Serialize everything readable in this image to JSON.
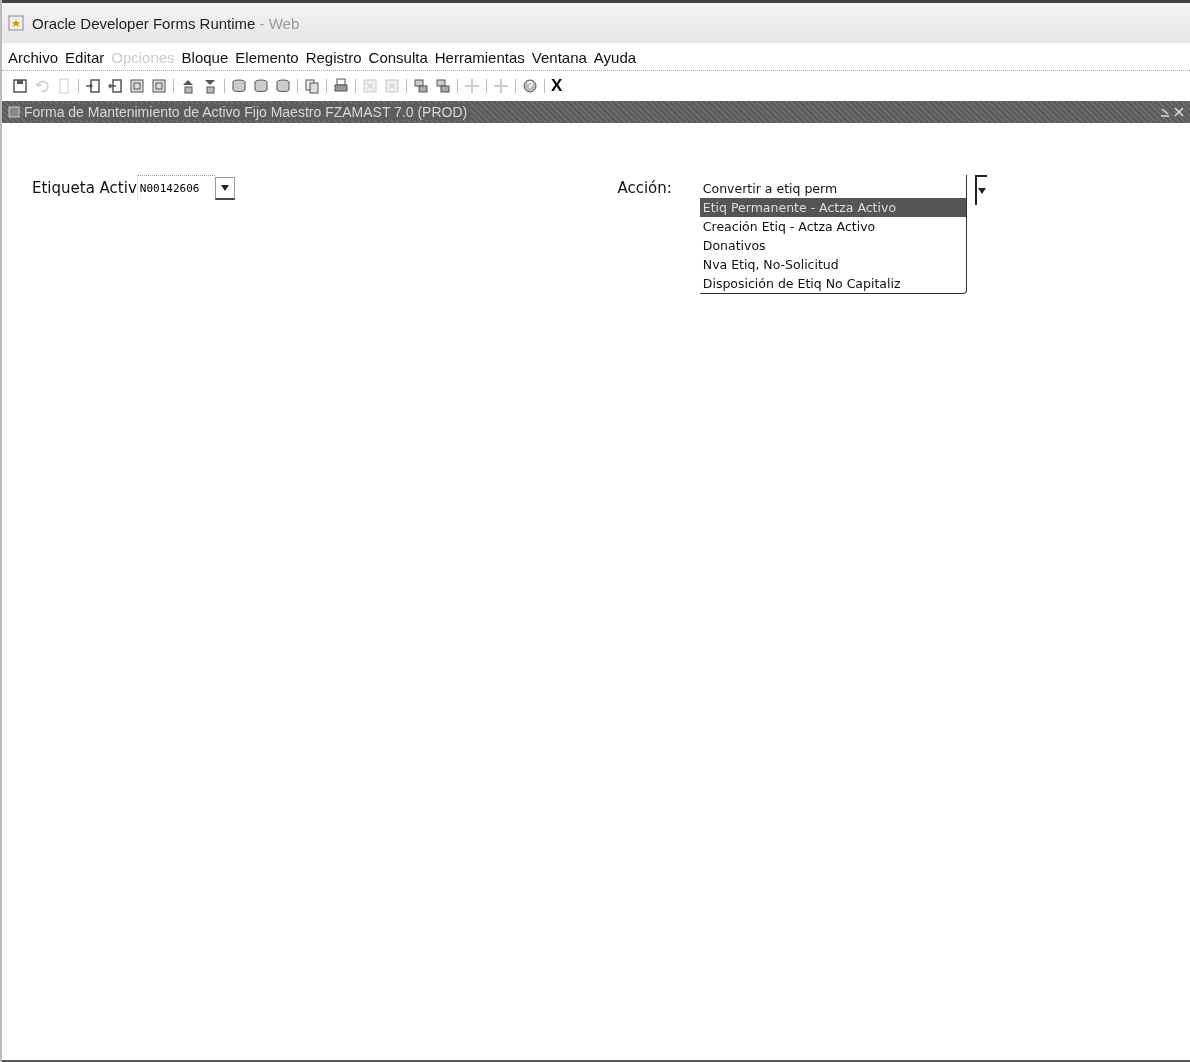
{
  "window": {
    "title": "Oracle Developer Forms Runtime",
    "title_suffix": " - Web"
  },
  "menu": [
    {
      "label": "Archivo",
      "disabled": false
    },
    {
      "label": "Editar",
      "disabled": false
    },
    {
      "label": "Opciones",
      "disabled": true
    },
    {
      "label": "Bloque",
      "disabled": false
    },
    {
      "label": "Elemento",
      "disabled": false
    },
    {
      "label": "Registro",
      "disabled": false
    },
    {
      "label": "Consulta",
      "disabled": false
    },
    {
      "label": "Herramientas",
      "disabled": false
    },
    {
      "label": "Ventana",
      "disabled": false
    },
    {
      "label": "Ayuda",
      "disabled": false
    }
  ],
  "toolbar": [
    [
      {
        "kind": "save",
        "disabled": false
      },
      {
        "kind": "undo",
        "disabled": true
      },
      {
        "kind": "page",
        "disabled": true
      }
    ],
    [
      {
        "kind": "enter",
        "disabled": false
      },
      {
        "kind": "exit",
        "disabled": false
      },
      {
        "kind": "doc",
        "disabled": false
      },
      {
        "kind": "doc",
        "disabled": false
      }
    ],
    [
      {
        "kind": "up",
        "disabled": false
      },
      {
        "kind": "down",
        "disabled": false
      }
    ],
    [
      {
        "kind": "db",
        "disabled": false
      },
      {
        "kind": "db",
        "disabled": false
      },
      {
        "kind": "db",
        "disabled": false
      }
    ],
    [
      {
        "kind": "copy",
        "disabled": false
      }
    ],
    [
      {
        "kind": "print",
        "disabled": false
      }
    ],
    [
      {
        "kind": "grid",
        "disabled": true
      },
      {
        "kind": "grid",
        "disabled": true
      }
    ],
    [
      {
        "kind": "block",
        "disabled": false
      },
      {
        "kind": "block",
        "disabled": false
      }
    ],
    [
      {
        "kind": "arrows",
        "disabled": true
      }
    ],
    [
      {
        "kind": "arrows",
        "disabled": true
      }
    ],
    [
      {
        "kind": "help",
        "disabled": false
      }
    ]
  ],
  "exit_label": "X",
  "form": {
    "title": "Forma de Mantenimiento de Activo Fijo Maestro  FZAMAST  7.0  (PROD)",
    "tag_label": "Etiqueta Activ",
    "tag_value": "N00142606",
    "action_label": "Acción:",
    "action_value": "Convertir a etiq perm",
    "options": [
      {
        "label": "Etiq Permanente - Actza Activo",
        "selected": true
      },
      {
        "label": "Creación Etiq - Actza Activo",
        "selected": false
      },
      {
        "label": "Donativos",
        "selected": false
      },
      {
        "label": "Nva Etiq, No-Solicitud",
        "selected": false
      },
      {
        "label": "Disposición de Etiq No Capitaliz",
        "selected": false
      }
    ]
  }
}
